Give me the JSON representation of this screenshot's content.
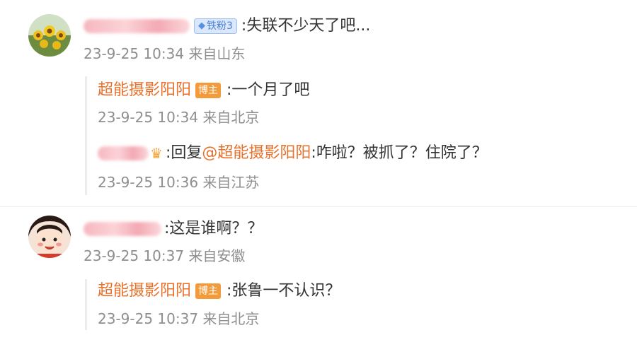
{
  "comments": [
    {
      "text": ":失联不少天了吧...",
      "badge": "铁粉3",
      "time": "23-9-25 10:34 来自山东",
      "replies": [
        {
          "author": "超能摄影阳阳",
          "badge": "博主",
          "text": ":一个月了吧",
          "time": "23-9-25 10:34 来自北京"
        },
        {
          "text_prefix": ":回复",
          "mention": "@超能摄影阳阳",
          "text": ":咋啦？被抓了？住院了？",
          "time": "23-9-25 10:36 来自江苏"
        }
      ]
    },
    {
      "text": ":这是谁啊？？",
      "time": "23-9-25 10:37 来自安徽",
      "replies": [
        {
          "author": "超能摄影阳阳",
          "badge": "博主",
          "text": ":张鲁一不认识？",
          "time": "23-9-25 10:37 来自北京"
        }
      ]
    }
  ]
}
